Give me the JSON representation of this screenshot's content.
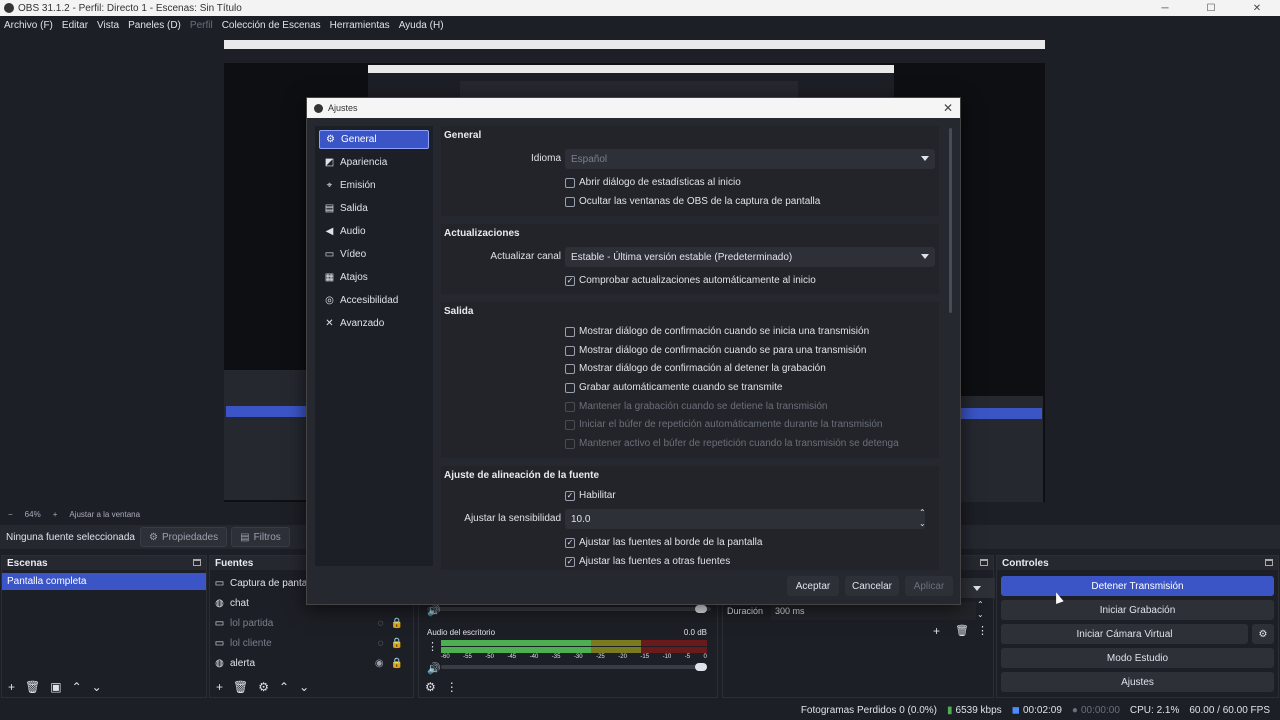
{
  "window": {
    "title": "OBS 31.1.2 - Perfil: Directo 1 - Escenas: Sin Título",
    "controls": [
      "─",
      "☐",
      "✕"
    ]
  },
  "menu": [
    "Archivo (F)",
    "Editar",
    "Vista",
    "Paneles (D)",
    "Perfil",
    "Colección de Escenas",
    "Herramientas",
    "Ayuda (H)"
  ],
  "zoom": {
    "minus": "−",
    "level": "64%",
    "plus": "+",
    "fit": "Ajustar a la ventana"
  },
  "source_toolbar": {
    "no_source": "Ninguna fuente seleccionada",
    "properties": "Propiedades",
    "filters": "Filtros"
  },
  "scenes": {
    "title": "Escenas",
    "items": [
      "Pantalla completa"
    ]
  },
  "sources": {
    "title": "Fuentes",
    "items": [
      {
        "name": "Captura de pantalla",
        "dim": false
      },
      {
        "name": "chat",
        "dim": false
      },
      {
        "name": "lol partida",
        "dim": true
      },
      {
        "name": "lol cliente",
        "dim": true
      },
      {
        "name": "alerta",
        "dim": false
      }
    ]
  },
  "mixer": {
    "track_name": "Audio del escritorio",
    "db": "0.0 dB",
    "scale": [
      "-60",
      "-55",
      "-50",
      "-45",
      "-40",
      "-35",
      "-30",
      "-25",
      "-20",
      "-15",
      "-10",
      "-5",
      "0"
    ]
  },
  "transition": {
    "duration_label": "Duración",
    "duration_value": "300 ms"
  },
  "controls": {
    "title": "Controles",
    "buttons": [
      "Detener Transmisión",
      "Iniciar Grabación",
      "Iniciar Cámara Virtual",
      "Modo Estudio",
      "Ajustes"
    ]
  },
  "status": {
    "dropped": "Fotogramas Perdidos 0 (0.0%)",
    "bitrate": "6539 kbps",
    "stream_time": "00:02:09",
    "rec_time": "00:00:00",
    "cpu": "CPU: 2.1%",
    "fps": "60.00 / 60.00 FPS"
  },
  "settings": {
    "title": "Ajustes",
    "sidebar": [
      "General",
      "Apariencia",
      "Emisión",
      "Salida",
      "Audio",
      "Vídeo",
      "Atajos",
      "Accesibilidad",
      "Avanzado"
    ],
    "general": {
      "heading": "General",
      "language_label": "Idioma",
      "language_value": "Español",
      "stats_dialog": "Abrir diálogo de estadísticas al inicio",
      "hide_windows": "Ocultar las ventanas de OBS de la captura de pantalla"
    },
    "updates": {
      "heading": "Actualizaciones",
      "channel_label": "Actualizar canal",
      "channel_value": "Estable - Última versión estable (Predeterminado)",
      "auto_check": "Comprobar actualizaciones automáticamente al inicio"
    },
    "output": {
      "heading": "Salida",
      "options": [
        {
          "label": "Mostrar diálogo de confirmación cuando se inicia una transmisión",
          "checked": false,
          "disabled": false
        },
        {
          "label": "Mostrar diálogo de confirmación cuando se para una transmisión",
          "checked": false,
          "disabled": false
        },
        {
          "label": "Mostrar diálogo de confirmación al detener la grabación",
          "checked": false,
          "disabled": false
        },
        {
          "label": "Grabar automáticamente cuando se transmite",
          "checked": false,
          "disabled": false
        },
        {
          "label": "Mantener la grabación cuando se detiene la transmisión",
          "checked": false,
          "disabled": true
        },
        {
          "label": "Iniciar el búfer de repetición automáticamente durante la transmisión",
          "checked": false,
          "disabled": true
        },
        {
          "label": "Mantener activo el búfer de repetición cuando la transmisión se detenga",
          "checked": false,
          "disabled": true
        }
      ]
    },
    "snapping": {
      "heading": "Ajuste de alineación de la fuente",
      "enable": "Habilitar",
      "sensitivity_label": "Ajustar la sensibilidad",
      "sensitivity_value": "10.0",
      "screen_edge": "Ajustar las fuentes al borde de la pantalla",
      "other_sources": "Ajustar las fuentes a otras fuentes"
    },
    "buttons": {
      "accept": "Aceptar",
      "cancel": "Cancelar",
      "apply": "Aplicar"
    }
  }
}
